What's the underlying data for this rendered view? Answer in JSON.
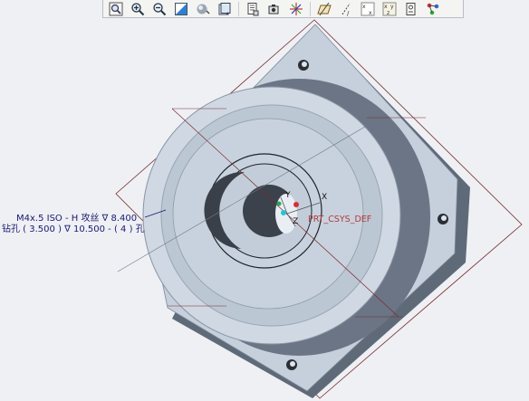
{
  "toolbar": {
    "buttons": [
      {
        "name": "refit-icon"
      },
      {
        "name": "zoom-in-icon"
      },
      {
        "name": "zoom-out-icon"
      },
      {
        "name": "repaint-icon"
      },
      {
        "name": "display-style-icon"
      },
      {
        "name": "saved-views-icon"
      },
      {
        "name": "layers-icon"
      },
      {
        "name": "spin-center-icon"
      },
      {
        "name": "datum-planes-icon"
      },
      {
        "name": "datum-axes-icon"
      },
      {
        "name": "datum-points-icon"
      },
      {
        "name": "csys-display-icon"
      },
      {
        "name": "annotation-display-icon"
      },
      {
        "name": "view-manager-icon"
      }
    ]
  },
  "annotation": {
    "line1": "M4x.5 ISO - H 攻丝 ∇ 8.400",
    "line2": "钻孔 ( 3.500 ) ∇ 10.500  - ( 4 ) 孔"
  },
  "csys": {
    "label": "PRT_CSYS_DEF",
    "x_label": "X",
    "y_label": "Y",
    "z_label": "Z"
  },
  "colors": {
    "background": "#eef0f4",
    "part_light": "#c9d3e0",
    "part_mid": "#a7b3c3",
    "part_dark": "#6c7686",
    "datum_plane": "#7a2b2b",
    "annotation_text": "#1a1a6e",
    "csys_label": "#b23a3a"
  }
}
